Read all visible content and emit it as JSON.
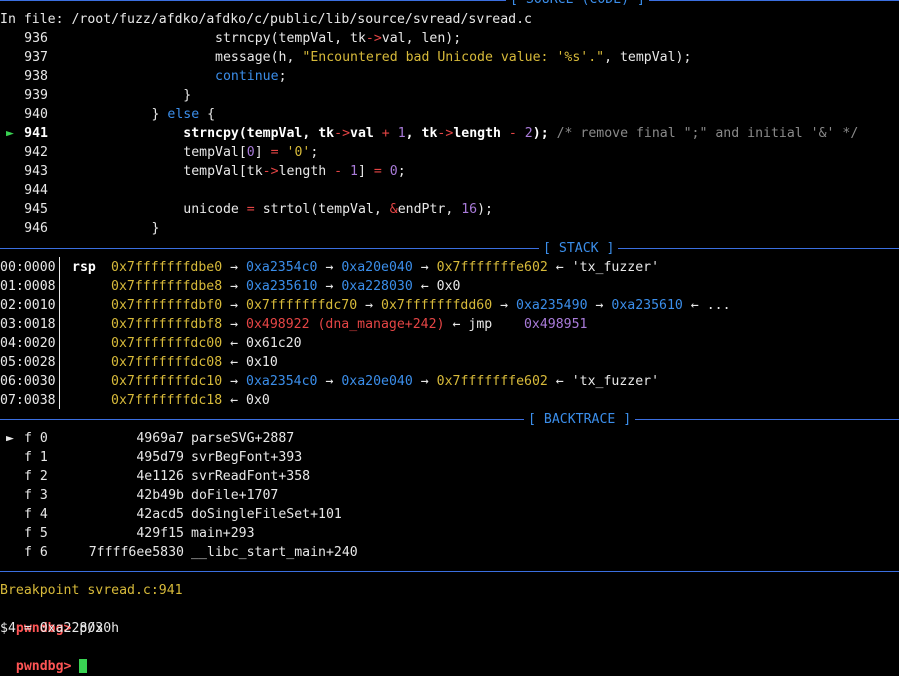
{
  "source": {
    "header": "[ SOURCE (CODE) ]",
    "file_label": "In file: /root/fuzz/afdko/afdko/c/public/lib/source/svread/svread.c",
    "current_marker": "►",
    "lines": [
      {
        "num": "936",
        "text": "                strncpy(tempVal, tk->val, len);"
      },
      {
        "num": "937",
        "text": "                message(h, \"Encountered bad Unicode value: '%s'.\", tempVal);"
      },
      {
        "num": "938",
        "text": "                continue;"
      },
      {
        "num": "939",
        "text": "            }"
      },
      {
        "num": "940",
        "text": "        } else {"
      },
      {
        "num": "941",
        "text": "            strncpy(tempVal, tk->val + 1, tk->length - 2); /* remove final \";\" and initial '&' */"
      },
      {
        "num": "942",
        "text": "            tempVal[0] = '0';"
      },
      {
        "num": "943",
        "text": "            tempVal[tk->length - 1] = 0;"
      },
      {
        "num": "944",
        "text": ""
      },
      {
        "num": "945",
        "text": "            unicode = strtol(tempVal, &endPtr, 16);"
      },
      {
        "num": "946",
        "text": "        }"
      }
    ]
  },
  "stack": {
    "header": "[ STACK ]",
    "rows": [
      {
        "offset": "00:0000",
        "reg": "rsp",
        "addr": "0x7fffffffdbe0",
        "chain": [
          {
            "t": "→",
            "c": "white"
          },
          {
            "t": "0xa2354c0",
            "c": "blue"
          },
          {
            "t": "→",
            "c": "white"
          },
          {
            "t": "0xa20e040",
            "c": "blue"
          },
          {
            "t": "→",
            "c": "white"
          },
          {
            "t": "0x7fffffffe602",
            "c": "yellow"
          },
          {
            "t": "←",
            "c": "white"
          },
          {
            "t": "'tx_fuzzer'",
            "c": "white"
          }
        ]
      },
      {
        "offset": "01:0008",
        "reg": "",
        "addr": "0x7fffffffdbe8",
        "chain": [
          {
            "t": "→",
            "c": "white"
          },
          {
            "t": "0xa235610",
            "c": "blue"
          },
          {
            "t": "→",
            "c": "white"
          },
          {
            "t": "0xa228030",
            "c": "blue"
          },
          {
            "t": "←",
            "c": "white"
          },
          {
            "t": "0x0",
            "c": "white"
          }
        ]
      },
      {
        "offset": "02:0010",
        "reg": "",
        "addr": "0x7fffffffdbf0",
        "chain": [
          {
            "t": "→",
            "c": "white"
          },
          {
            "t": "0x7fffffffdc70",
            "c": "yellow"
          },
          {
            "t": "→",
            "c": "white"
          },
          {
            "t": "0x7fffffffdd60",
            "c": "yellow"
          },
          {
            "t": "→",
            "c": "white"
          },
          {
            "t": "0xa235490",
            "c": "blue"
          },
          {
            "t": "→",
            "c": "white"
          },
          {
            "t": "0xa235610",
            "c": "blue"
          },
          {
            "t": "←",
            "c": "white"
          },
          {
            "t": "...",
            "c": "white"
          }
        ]
      },
      {
        "offset": "03:0018",
        "reg": "",
        "addr": "0x7fffffffdbf8",
        "chain": [
          {
            "t": "→",
            "c": "white"
          },
          {
            "t": "0x498922 (dna_manage+242)",
            "c": "red"
          },
          {
            "t": "←",
            "c": "white"
          },
          {
            "t": "jmp   ",
            "c": "white"
          },
          {
            "t": "0x498951",
            "c": "purple"
          }
        ]
      },
      {
        "offset": "04:0020",
        "reg": "",
        "addr": "0x7fffffffdc00",
        "chain": [
          {
            "t": "←",
            "c": "white"
          },
          {
            "t": "0x61c20",
            "c": "white"
          }
        ]
      },
      {
        "offset": "05:0028",
        "reg": "",
        "addr": "0x7fffffffdc08",
        "chain": [
          {
            "t": "←",
            "c": "white"
          },
          {
            "t": "0x10",
            "c": "white"
          }
        ]
      },
      {
        "offset": "06:0030",
        "reg": "",
        "addr": "0x7fffffffdc10",
        "chain": [
          {
            "t": "→",
            "c": "white"
          },
          {
            "t": "0xa2354c0",
            "c": "blue"
          },
          {
            "t": "→",
            "c": "white"
          },
          {
            "t": "0xa20e040",
            "c": "blue"
          },
          {
            "t": "→",
            "c": "white"
          },
          {
            "t": "0x7fffffffe602",
            "c": "yellow"
          },
          {
            "t": "←",
            "c": "white"
          },
          {
            "t": "'tx_fuzzer'",
            "c": "white"
          }
        ]
      },
      {
        "offset": "07:0038",
        "reg": "",
        "addr": "0x7fffffffdc18",
        "chain": [
          {
            "t": "←",
            "c": "white"
          },
          {
            "t": "0x0",
            "c": "white"
          }
        ]
      }
    ]
  },
  "backtrace": {
    "header": "[ BACKTRACE ]",
    "frames": [
      {
        "marker": "►",
        "frame": "f 0",
        "addr": "4969a7",
        "sym": "parseSVG+2887"
      },
      {
        "marker": "",
        "frame": "f 1",
        "addr": "495d79",
        "sym": "svrBegFont+393"
      },
      {
        "marker": "",
        "frame": "f 2",
        "addr": "4e1126",
        "sym": "svrReadFont+358"
      },
      {
        "marker": "",
        "frame": "f 3",
        "addr": "42b49b",
        "sym": "doFile+1707"
      },
      {
        "marker": "",
        "frame": "f 4",
        "addr": "42acd5",
        "sym": "doSingleFileSet+101"
      },
      {
        "marker": "",
        "frame": "f 5",
        "addr": "429f15",
        "sym": "main+293"
      },
      {
        "marker": "",
        "frame": "f 6",
        "addr": "7ffff6ee5830",
        "sym": "__libc_start_main+240"
      }
    ]
  },
  "console": {
    "breakpoint": "Breakpoint svread.c:941",
    "prompt": "pwndbg>",
    "command": " p/x h",
    "result": "$4 = 0xa228030",
    "next_prompt": "pwndbg>"
  },
  "colors": {
    "background": "#000000",
    "divider": "#3b6fe0",
    "header": "#3b8eea",
    "pointer_blue": "#3b8eea",
    "stack_yellow": "#d7ba3a",
    "code_red": "#e54545",
    "cursor_green": "#39d353"
  }
}
